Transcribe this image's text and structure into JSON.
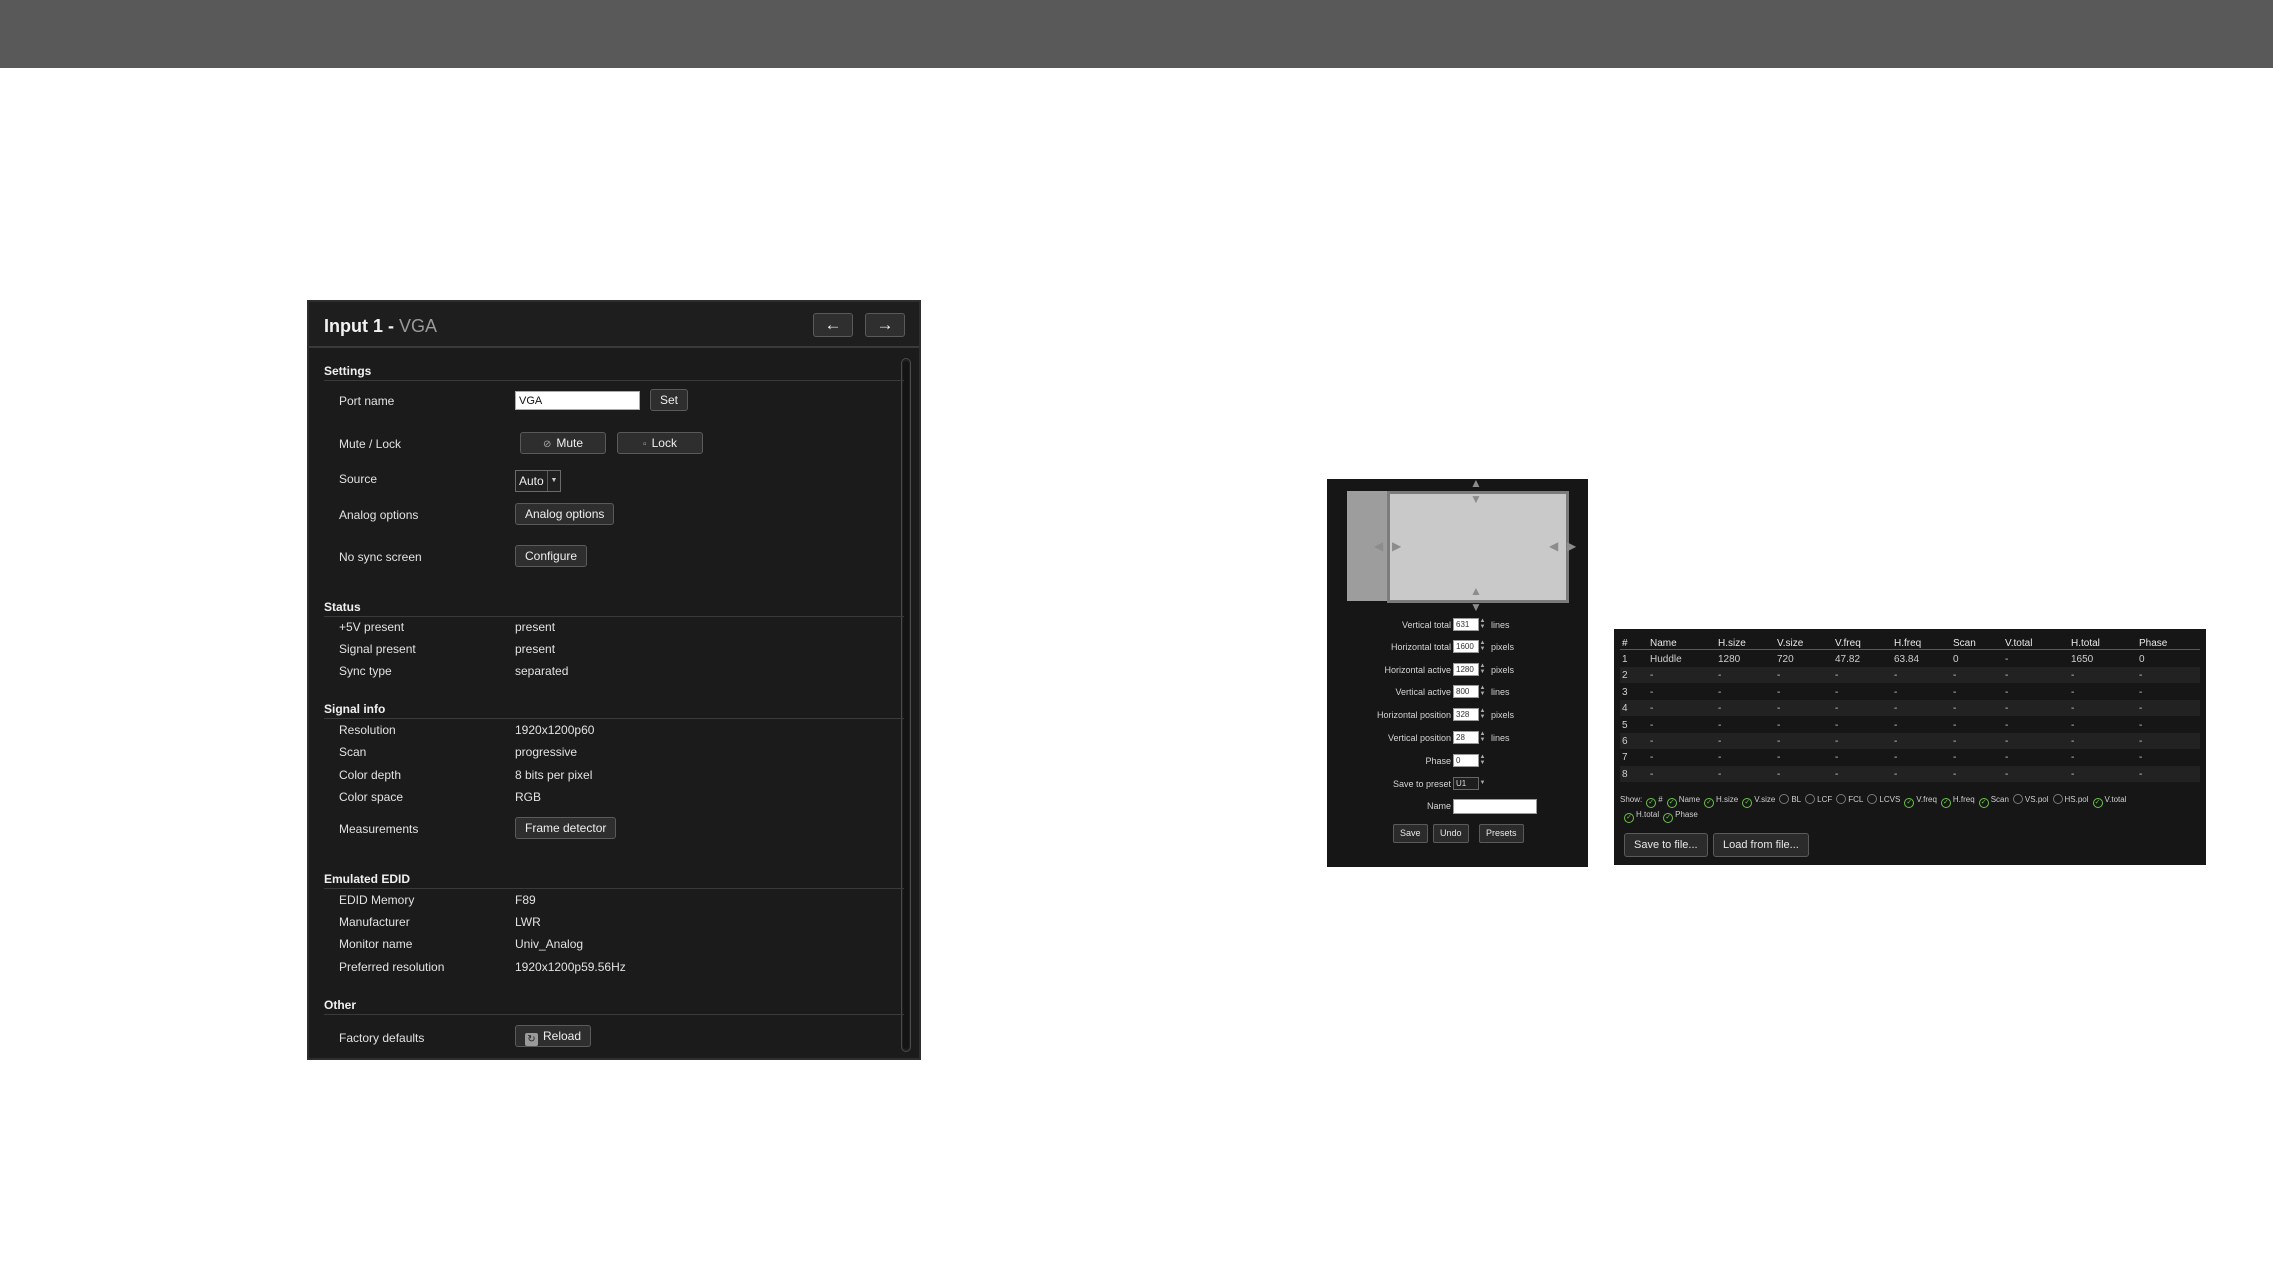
{
  "input_panel": {
    "title": "Input 1 - ",
    "subtitle": "VGA",
    "prev_icon": "←",
    "next_icon": "→",
    "sections": {
      "settings": "Settings",
      "status": "Status",
      "signal_info": "Signal info",
      "emulated_edid": "Emulated EDID",
      "other": "Other"
    },
    "settings": {
      "port_name_label": "Port name",
      "port_name_value": "VGA",
      "set_label": "Set",
      "mute_lock_label": "Mute / Lock",
      "mute_label": "Mute",
      "lock_label": "Lock",
      "source_label": "Source",
      "source_value": "Auto",
      "analog_options_label": "Analog options",
      "analog_options_button": "Analog options",
      "no_sync_label": "No sync screen",
      "configure_button": "Configure"
    },
    "status": [
      {
        "label": "+5V present",
        "value": "present"
      },
      {
        "label": "Signal present",
        "value": "present"
      },
      {
        "label": "Sync type",
        "value": "separated"
      }
    ],
    "signal_info": [
      {
        "label": "Resolution",
        "value": "1920x1200p60"
      },
      {
        "label": "Scan",
        "value": "progressive"
      },
      {
        "label": "Color depth",
        "value": "8 bits per pixel"
      },
      {
        "label": "Color space",
        "value": "RGB"
      }
    ],
    "measurements_label": "Measurements",
    "frame_detector_button": "Frame detector",
    "emulated_edid": [
      {
        "label": "EDID Memory",
        "value": "F89"
      },
      {
        "label": "Manufacturer",
        "value": "LWR"
      },
      {
        "label": "Monitor name",
        "value": "Univ_Analog"
      },
      {
        "label": "Preferred resolution",
        "value": "1920x1200p59.56Hz"
      }
    ],
    "factory_defaults_label": "Factory defaults",
    "reload_button": "Reload"
  },
  "analog_panel": {
    "rows": [
      {
        "label": "Vertical total",
        "value": "631",
        "unit": "lines"
      },
      {
        "label": "Horizontal total",
        "value": "1600",
        "unit": "pixels"
      },
      {
        "label": "Horizontal active",
        "value": "1280",
        "unit": "pixels"
      },
      {
        "label": "Vertical active",
        "value": "800",
        "unit": "lines"
      },
      {
        "label": "Horizontal position",
        "value": "328",
        "unit": "pixels"
      },
      {
        "label": "Vertical position",
        "value": "28",
        "unit": "lines"
      },
      {
        "label": "Phase",
        "value": "0",
        "unit": ""
      },
      {
        "label": "Save to preset",
        "value": "U1",
        "unit": ""
      }
    ],
    "name_label": "Name",
    "save_button": "Save",
    "undo_button": "Undo",
    "presets_button": "Presets"
  },
  "frame_panel": {
    "columns": [
      "#",
      "Name",
      "H.size",
      "V.size",
      "V.freq",
      "H.freq",
      "Scan",
      "V.total",
      "H.total",
      "Phase"
    ],
    "rows": [
      [
        "1",
        "Huddle",
        "1280",
        "720",
        "47.82",
        "63.84",
        "0",
        "-",
        "1650",
        "0"
      ],
      [
        "2",
        "-",
        "-",
        "-",
        "-",
        "-",
        "-",
        "-",
        "-",
        "-"
      ],
      [
        "3",
        "-",
        "-",
        "-",
        "-",
        "-",
        "-",
        "-",
        "-",
        "-"
      ],
      [
        "4",
        "-",
        "-",
        "-",
        "-",
        "-",
        "-",
        "-",
        "-",
        "-"
      ],
      [
        "5",
        "-",
        "-",
        "-",
        "-",
        "-",
        "-",
        "-",
        "-",
        "-"
      ],
      [
        "6",
        "-",
        "-",
        "-",
        "-",
        "-",
        "-",
        "-",
        "-",
        "-"
      ],
      [
        "7",
        "-",
        "-",
        "-",
        "-",
        "-",
        "-",
        "-",
        "-",
        "-"
      ],
      [
        "8",
        "-",
        "-",
        "-",
        "-",
        "-",
        "-",
        "-",
        "-",
        "-"
      ]
    ],
    "show_label": "Show:",
    "show_options": [
      {
        "label": "#",
        "checked": true
      },
      {
        "label": "Name",
        "checked": true
      },
      {
        "label": "H.size",
        "checked": true
      },
      {
        "label": "V.size",
        "checked": true
      },
      {
        "label": "BL",
        "checked": false
      },
      {
        "label": "LCF",
        "checked": false
      },
      {
        "label": "FCL",
        "checked": false
      },
      {
        "label": "LCVS",
        "checked": false
      },
      {
        "label": "V.freq",
        "checked": true
      },
      {
        "label": "H.freq",
        "checked": true
      },
      {
        "label": "Scan",
        "checked": true
      },
      {
        "label": "VS.pol",
        "checked": false
      },
      {
        "label": "HS.pol",
        "checked": false
      },
      {
        "label": "V.total",
        "checked": true
      },
      {
        "label": "H.total",
        "checked": true
      },
      {
        "label": "Phase",
        "checked": true
      }
    ],
    "save_to_file_button": "Save to file...",
    "load_from_file_button": "Load from file..."
  }
}
